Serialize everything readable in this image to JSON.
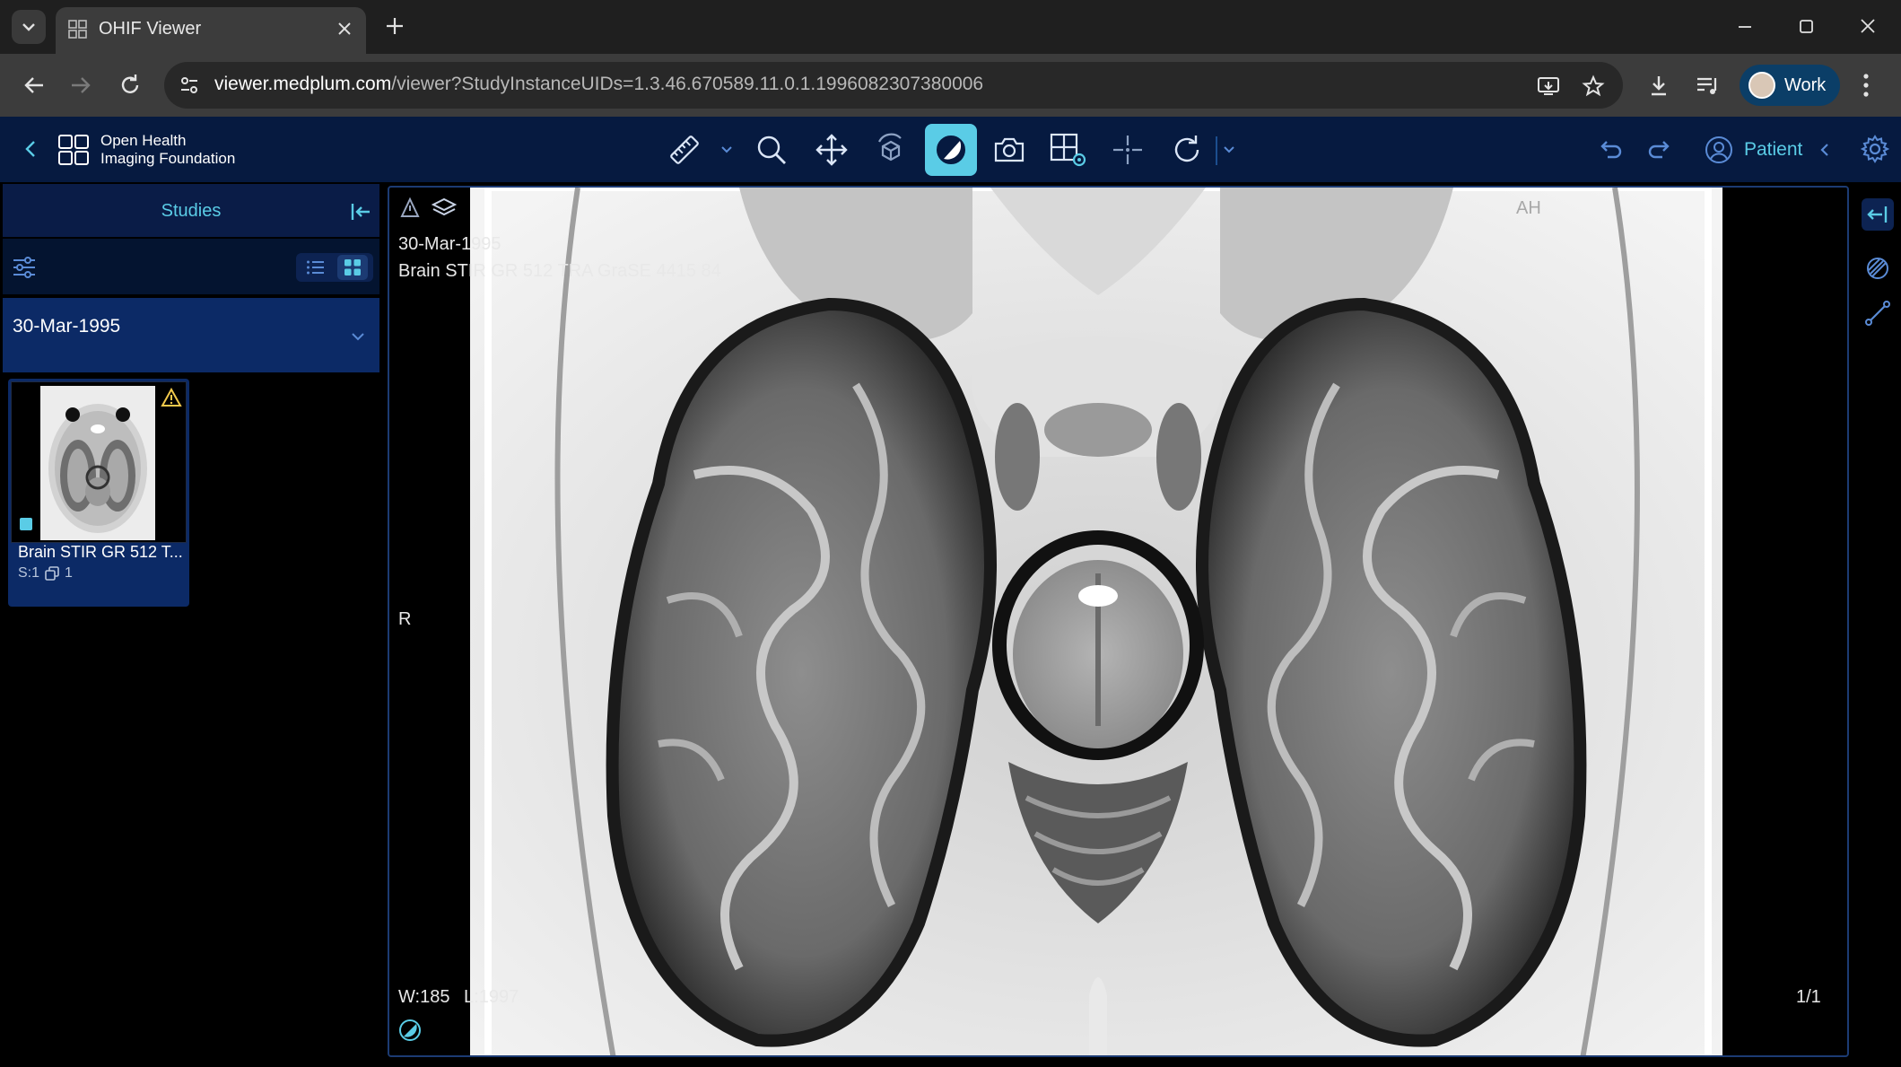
{
  "browser": {
    "tab_title": "OHIF Viewer",
    "url_host": "viewer.medplum.com",
    "url_rest": "/viewer?StudyInstanceUIDs=1.3.46.670589.11.0.1.1996082307380006",
    "profile_name": "Work"
  },
  "header": {
    "logo_line1": "Open Health",
    "logo_line2": "Imaging Foundation",
    "tools": [
      "measure-icon",
      "zoom-icon",
      "pan-icon",
      "rotate-3d-icon",
      "window-level-icon",
      "capture-icon",
      "layout-icon",
      "crosshairs-icon",
      "reset-icon"
    ],
    "active_tool": "window-level-icon",
    "patient_label": "Patient",
    "accent": "#5acce6"
  },
  "left_panel": {
    "tab_label": "Studies",
    "study": {
      "date": "30-Mar-1995",
      "series": [
        {
          "description": "Brain STIR GR 512 T...",
          "series_number": "S:1",
          "instances": "1",
          "warning": true
        }
      ]
    }
  },
  "viewport": {
    "orientation_top": "AH",
    "orientation_left": "R",
    "study_date": "30-Mar-1995",
    "series_description": "Brain STIR GR 512 TRA GraSE 4415 84",
    "window_label": "W:",
    "window_value": "185",
    "level_label": "L:",
    "level_value": "1997",
    "image_index": "1/1"
  }
}
